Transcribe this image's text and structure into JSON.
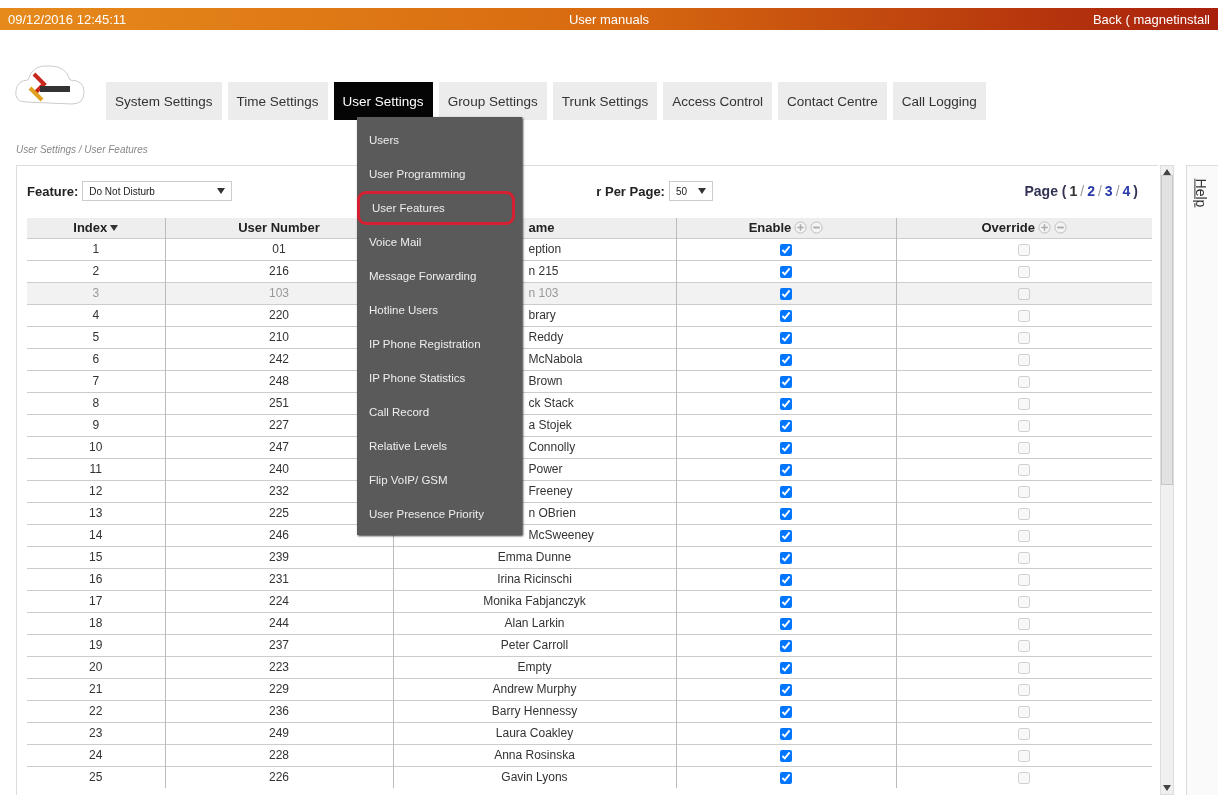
{
  "top_bar": {
    "datetime": "09/12/2016  12:45:11",
    "title": "User manuals",
    "back_link": "Back ( magnetinstall"
  },
  "nav_tabs": [
    {
      "label": "System Settings",
      "selected": false
    },
    {
      "label": "Time Settings",
      "selected": false
    },
    {
      "label": "User Settings",
      "selected": true
    },
    {
      "label": "Group Settings",
      "selected": false
    },
    {
      "label": "Trunk Settings",
      "selected": false
    },
    {
      "label": "Access Control",
      "selected": false
    },
    {
      "label": "Contact Centre",
      "selected": false
    },
    {
      "label": "Call Logging",
      "selected": false
    }
  ],
  "dropdown_menu": [
    {
      "label": "Users",
      "selected": false
    },
    {
      "label": "User Programming",
      "selected": false
    },
    {
      "label": "User Features",
      "selected": true
    },
    {
      "label": "Voice Mail",
      "selected": false
    },
    {
      "label": "Message Forwarding",
      "selected": false
    },
    {
      "label": "Hotline Users",
      "selected": false
    },
    {
      "label": "IP Phone Registration",
      "selected": false
    },
    {
      "label": "IP Phone Statistics",
      "selected": false
    },
    {
      "label": "Call Record",
      "selected": false
    },
    {
      "label": "Relative Levels",
      "selected": false
    },
    {
      "label": "Flip VoIP/ GSM",
      "selected": false
    },
    {
      "label": "User Presence Priority",
      "selected": false
    }
  ],
  "breadcrumb": "User Settings / User Features",
  "feature_filter": {
    "label": "Feature:",
    "value": "Do Not Disturb"
  },
  "per_page": {
    "label": "r Per Page:",
    "value": "50"
  },
  "pagination": {
    "label": "Page (",
    "close": ")",
    "separator": "/",
    "pages": [
      {
        "label": "1",
        "selected": true
      },
      {
        "label": "2",
        "selected": false
      },
      {
        "label": "3",
        "selected": false
      },
      {
        "label": "4",
        "selected": false
      }
    ]
  },
  "table": {
    "columns": [
      {
        "label": "Index",
        "kind": "sort"
      },
      {
        "label": "User Number",
        "kind": "text"
      },
      {
        "label": "ame",
        "kind": "text"
      },
      {
        "label": "Enable",
        "kind": "checkbox",
        "disabled": false
      },
      {
        "label": "Override",
        "kind": "checkbox",
        "disabled": true
      }
    ],
    "rows": [
      {
        "cells": [
          "1",
          "01",
          "eption"
        ],
        "enable": true,
        "override": false,
        "disabled": false
      },
      {
        "cells": [
          "2",
          "216",
          "n 215"
        ],
        "enable": true,
        "override": false,
        "disabled": false
      },
      {
        "cells": [
          "3",
          "103",
          "n 103"
        ],
        "enable": true,
        "override": false,
        "disabled": true
      },
      {
        "cells": [
          "4",
          "220",
          "brary"
        ],
        "enable": true,
        "override": false,
        "disabled": false
      },
      {
        "cells": [
          "5",
          "210",
          "Reddy"
        ],
        "enable": true,
        "override": false,
        "disabled": false
      },
      {
        "cells": [
          "6",
          "242",
          "McNabola"
        ],
        "enable": true,
        "override": false,
        "disabled": false
      },
      {
        "cells": [
          "7",
          "248",
          "Brown"
        ],
        "enable": true,
        "override": false,
        "disabled": false
      },
      {
        "cells": [
          "8",
          "251",
          "ck Stack"
        ],
        "enable": true,
        "override": false,
        "disabled": false
      },
      {
        "cells": [
          "9",
          "227",
          "a Stojek"
        ],
        "enable": true,
        "override": false,
        "disabled": false
      },
      {
        "cells": [
          "10",
          "247",
          "Connolly"
        ],
        "enable": true,
        "override": false,
        "disabled": false
      },
      {
        "cells": [
          "11",
          "240",
          "Power"
        ],
        "enable": true,
        "override": false,
        "disabled": false
      },
      {
        "cells": [
          "12",
          "232",
          "Freeney"
        ],
        "enable": true,
        "override": false,
        "disabled": false
      },
      {
        "cells": [
          "13",
          "225",
          "n OBrien"
        ],
        "enable": true,
        "override": false,
        "disabled": false
      },
      {
        "cells": [
          "14",
          "246",
          "McSweeney"
        ],
        "enable": true,
        "override": false,
        "disabled": false
      },
      {
        "cells": [
          "15",
          "239",
          "Emma Dunne"
        ],
        "enable": true,
        "override": false,
        "disabled": false
      },
      {
        "cells": [
          "16",
          "231",
          "Irina Ricinschi"
        ],
        "enable": true,
        "override": false,
        "disabled": false
      },
      {
        "cells": [
          "17",
          "224",
          "Monika Fabjanczyk"
        ],
        "enable": true,
        "override": false,
        "disabled": false
      },
      {
        "cells": [
          "18",
          "244",
          "Alan Larkin"
        ],
        "enable": true,
        "override": false,
        "disabled": false
      },
      {
        "cells": [
          "19",
          "237",
          "Peter Carroll"
        ],
        "enable": true,
        "override": false,
        "disabled": false
      },
      {
        "cells": [
          "20",
          "223",
          "Empty"
        ],
        "enable": true,
        "override": false,
        "disabled": false
      },
      {
        "cells": [
          "21",
          "229",
          "Andrew Murphy"
        ],
        "enable": true,
        "override": false,
        "disabled": false
      },
      {
        "cells": [
          "22",
          "236",
          "Barry Hennessy"
        ],
        "enable": true,
        "override": false,
        "disabled": false
      },
      {
        "cells": [
          "23",
          "249",
          "Laura Coakley"
        ],
        "enable": true,
        "override": false,
        "disabled": false
      },
      {
        "cells": [
          "24",
          "228",
          "Anna Rosinska"
        ],
        "enable": true,
        "override": false,
        "disabled": false
      },
      {
        "cells": [
          "25",
          "226",
          "Gavin Lyons"
        ],
        "enable": true,
        "override": false,
        "disabled": false
      }
    ]
  },
  "help_tab": "Help"
}
